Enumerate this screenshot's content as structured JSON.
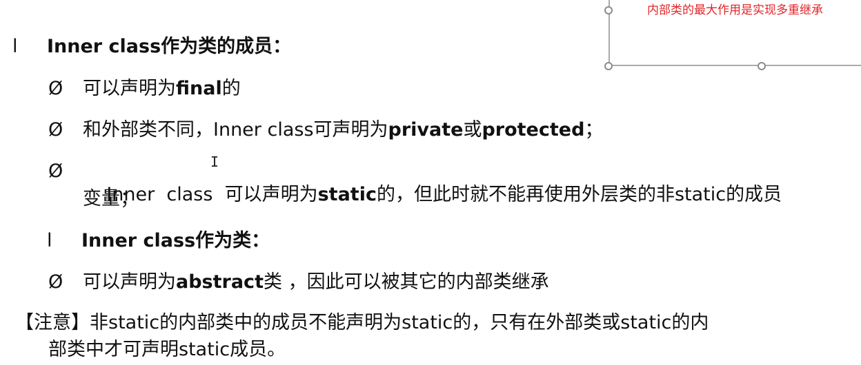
{
  "callout": {
    "text": "内部类的最大作用是实现多重继承"
  },
  "markers": {
    "bar": "l",
    "empty_set": "Ø"
  },
  "section1": {
    "heading": "Inner class作为类的成员：",
    "items": [
      {
        "parts": [
          "可以声明为",
          "final",
          "的"
        ]
      },
      {
        "parts": [
          "和外部类不同，Inner class可声明为",
          "private",
          "或",
          "protected",
          "；"
        ]
      },
      {
        "parts": [
          "Inner  class  可以声明为",
          "static",
          "的，但此时就不能再使用外层类的非static的成员"
        ],
        "continuation": "变量；"
      }
    ]
  },
  "section2": {
    "heading": "Inner class作为类：",
    "items": [
      {
        "parts": [
          "可以声明为",
          "abstract",
          "类 ，因此可以被其它的内部类继承"
        ]
      }
    ]
  },
  "note": {
    "line1": "【注意】非static的内部类中的成员不能声明为static的，只有在外部类或static的内",
    "line2": "部类中才可声明static成员。"
  }
}
